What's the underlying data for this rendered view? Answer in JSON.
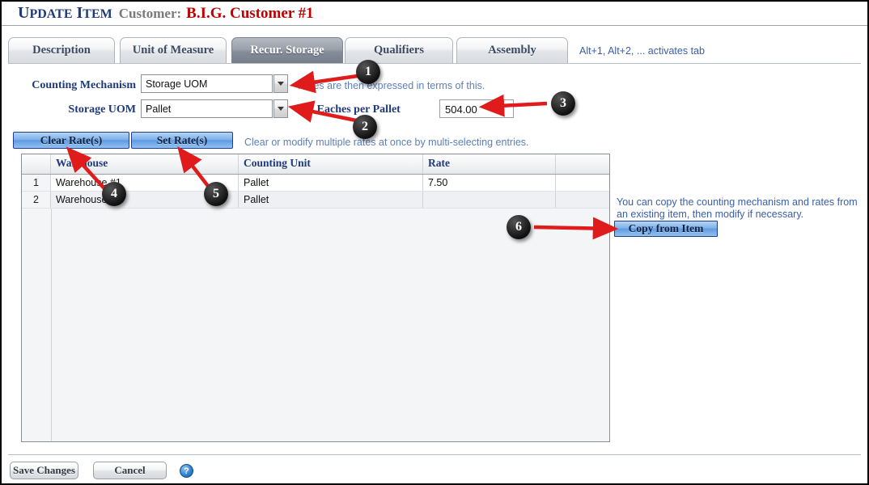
{
  "window": {
    "title_prefix": "Update Item",
    "title_prefix_caps": "U",
    "customer_label": "Customer:",
    "customer_value": "B.I.G. Customer #1"
  },
  "tabs": {
    "items": [
      {
        "label": "Description",
        "active": false
      },
      {
        "label": "Unit of Measure",
        "active": false
      },
      {
        "label": "Recur. Storage",
        "active": true
      },
      {
        "label": "Qualifiers",
        "active": false
      },
      {
        "label": "Assembly",
        "active": false
      }
    ],
    "hint": "Alt+1, Alt+2, ... activates tab"
  },
  "form": {
    "counting_mechanism_label": "Counting Mechanism",
    "counting_mechanism_value": "Storage UOM",
    "counting_mechanism_hint": "Rates are then expressed in terms of this.",
    "storage_uom_label": "Storage UOM",
    "storage_uom_value": "Pallet",
    "eaches_label": "# of Eaches per Pallet",
    "eaches_value": "504.00"
  },
  "actions": {
    "clear_rates_label": "Clear Rate(s)",
    "set_rates_label": "Set Rate(s)",
    "rates_hint": "Clear or modify multiple rates at once by multi-selecting entries."
  },
  "grid": {
    "columns": [
      "",
      "Warehouse",
      "Counting Unit",
      "Rate",
      ""
    ],
    "rows": [
      {
        "index": "1",
        "warehouse": "Warehouse #1",
        "counting_unit": "Pallet",
        "rate": "7.50",
        "extra": ""
      },
      {
        "index": "2",
        "warehouse": "Warehouse #2",
        "counting_unit": "Pallet",
        "rate": "",
        "extra": ""
      }
    ]
  },
  "side_panel": {
    "note": "You can copy the counting mechanism and rates from an existing item, then modify if necessary.",
    "copy_button_label": "Copy from Item"
  },
  "footer": {
    "save_label": "Save Changes",
    "cancel_label": "Cancel",
    "help_glyph": "?"
  },
  "annotations": {
    "markers": [
      {
        "number": "1"
      },
      {
        "number": "2"
      },
      {
        "number": "3"
      },
      {
        "number": "4"
      },
      {
        "number": "5"
      },
      {
        "number": "6"
      }
    ],
    "arrow_color": "#e01b1b"
  }
}
